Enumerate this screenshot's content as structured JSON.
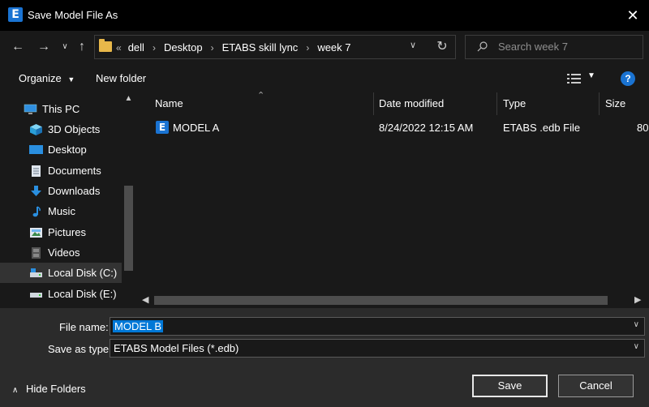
{
  "window": {
    "title": "Save Model File As",
    "app_icon_letter": "E",
    "close_glyph": "✕"
  },
  "nav": {
    "breadcrumb_overflow": "«",
    "breadcrumbs": [
      "dell",
      "Desktop",
      "ETABS skill lync",
      "week 7"
    ],
    "search_placeholder": "Search week 7"
  },
  "toolbar": {
    "organize_label": "Organize",
    "new_folder_label": "New folder",
    "help_glyph": "?"
  },
  "sidebar": {
    "items": [
      {
        "label": "This PC",
        "icon": "computer-icon"
      },
      {
        "label": "3D Objects",
        "icon": "cube-icon"
      },
      {
        "label": "Desktop",
        "icon": "desktop-icon"
      },
      {
        "label": "Documents",
        "icon": "document-icon"
      },
      {
        "label": "Downloads",
        "icon": "download-icon"
      },
      {
        "label": "Music",
        "icon": "music-icon"
      },
      {
        "label": "Pictures",
        "icon": "picture-icon"
      },
      {
        "label": "Videos",
        "icon": "video-icon"
      },
      {
        "label": "Local Disk (C:)",
        "icon": "drive-icon",
        "selected": true
      },
      {
        "label": "Local Disk (E:)",
        "icon": "drive-icon"
      }
    ]
  },
  "file_list": {
    "columns": [
      "Name",
      "Date modified",
      "Type",
      "Size"
    ],
    "rows": [
      {
        "name": "MODEL A",
        "icon_letter": "E",
        "date_modified": "8/24/2022 12:15 AM",
        "type": "ETABS .edb File",
        "size": "80"
      }
    ]
  },
  "bottom": {
    "file_name_label": "File name:",
    "file_name_value": "MODEL B",
    "save_type_label": "Save as type:",
    "save_type_value": "ETABS Model Files (*.edb)",
    "hide_folders_label": "Hide Folders",
    "save_label": "Save",
    "cancel_label": "Cancel"
  },
  "colors": {
    "accent": "#0078d7",
    "app_icon": "#1a73d2",
    "folder": "#e8b84a",
    "background": "#191919"
  }
}
